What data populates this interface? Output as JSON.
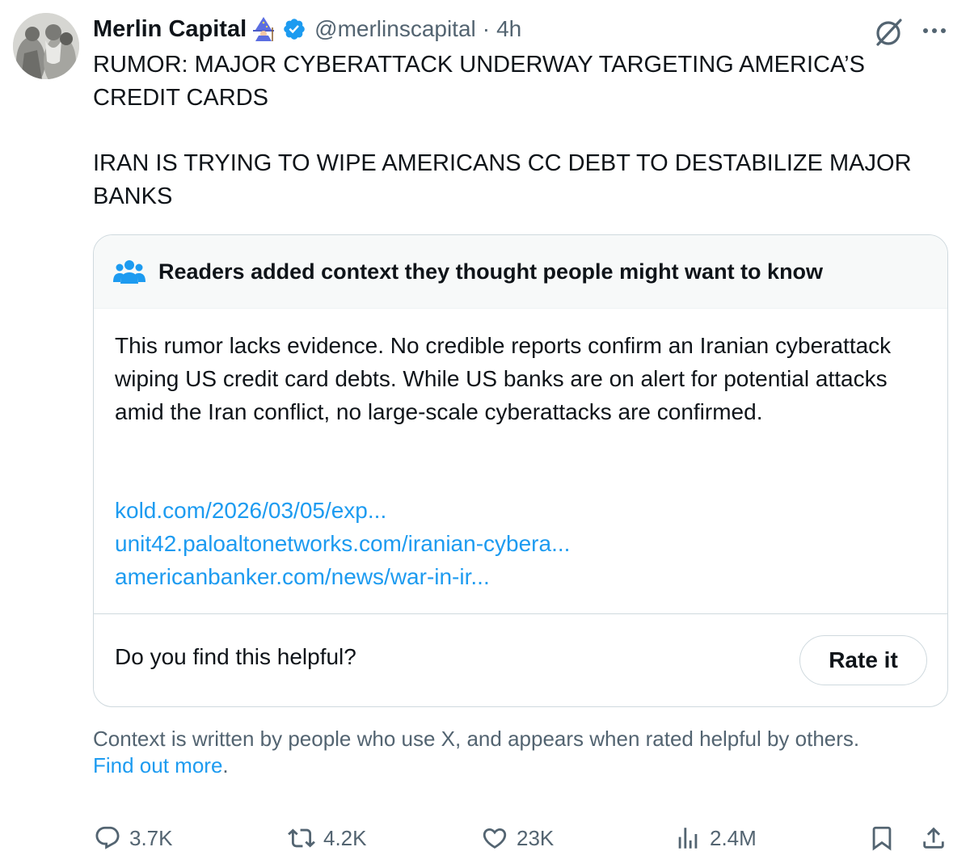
{
  "tweet": {
    "author": {
      "display_name": "Merlin Capital",
      "handle": "@merlinscapital",
      "time": "4h"
    },
    "separator": "·",
    "text_lines": [
      "RUMOR: MAJOR CYBERATTACK UNDERWAY TARGETING AMERICA’S CREDIT CARDS",
      "IRAN IS TRYING TO WIPE AMERICANS CC DEBT TO DESTABILIZE MAJOR BANKS"
    ]
  },
  "community_note": {
    "title": "Readers added context they thought people might want to know",
    "body": "This rumor lacks evidence. No credible reports confirm an Iranian cyberattack wiping US credit card debts. While US banks are on alert for potential attacks amid the Iran conflict, no large-scale cyberattacks are confirmed.",
    "links": [
      "kold.com/2026/03/05/exp...",
      "unit42.paloaltonetworks.com/iranian-cybera...",
      "americanbanker.com/news/war-in-ir..."
    ],
    "helpful_prompt": "Do you find this helpful?",
    "rate_label": "Rate it"
  },
  "context_footer": {
    "text": "Context is written by people who use X, and appears when rated helpful by others.",
    "link_text": "Find out more",
    "after_link": "."
  },
  "actions": {
    "replies": "3.7K",
    "reposts": "4.2K",
    "likes": "23K",
    "views": "2.4M"
  },
  "colors": {
    "text_primary": "#0f1419",
    "text_secondary": "#536471",
    "link": "#1d9bf0",
    "border": "#cfd9de",
    "note_header_bg": "#f7f9f9",
    "verified_badge": "#1d9bf0"
  },
  "icons": {
    "avatar": "avatar",
    "wizard_emoji": "mage-emoji",
    "verified": "verified-badge-icon",
    "grok": "grok-icon",
    "more": "more-icon",
    "people": "people-icon",
    "reply": "reply-icon",
    "repost": "repost-icon",
    "like": "like-icon",
    "views": "views-icon",
    "bookmark": "bookmark-icon",
    "share": "share-icon"
  }
}
